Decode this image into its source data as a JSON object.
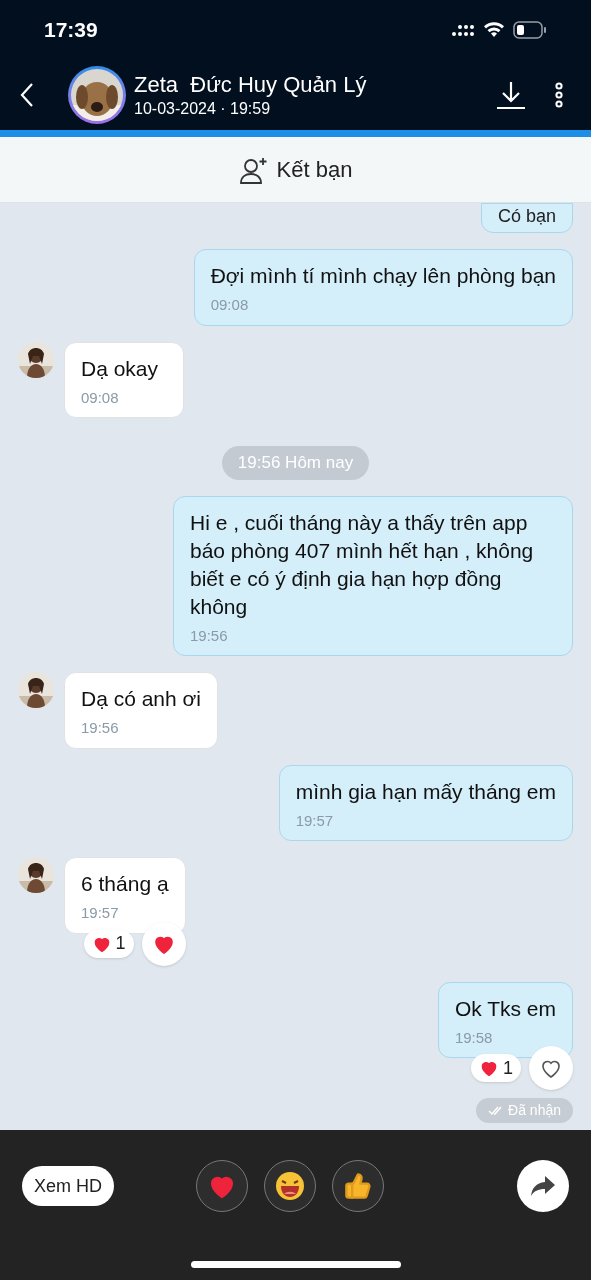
{
  "status_bar": {
    "time": "17:39"
  },
  "header": {
    "name": "Zeta  Đức Huy Quản Lý",
    "subtitle": "10-03-2024 · 19:59"
  },
  "friend_bar": {
    "label": "Kết bạn"
  },
  "messages": [
    {
      "kind": "clipped",
      "text": "Có bạn"
    },
    {
      "kind": "sent",
      "text": "Đợi mình tí mình chạy lên phòng bạn",
      "time": "09:08"
    },
    {
      "kind": "received",
      "text": "Dạ okay",
      "time": "09:08"
    },
    {
      "kind": "date",
      "text": "19:56 Hôm nay"
    },
    {
      "kind": "sent",
      "text": "Hi e , cuối tháng này a thấy trên app báo phòng 407 mình hết hạn , không biết e có ý định gia hạn hợp đồng không",
      "time": "19:56"
    },
    {
      "kind": "received",
      "text": "Dạ có anh ơi",
      "time": "19:56"
    },
    {
      "kind": "sent",
      "text": "mình gia hạn mấy tháng em",
      "time": "19:57"
    },
    {
      "kind": "received",
      "text": "6 tháng ạ",
      "time": "19:57",
      "reaction": {
        "count": "1",
        "reacted": true
      }
    },
    {
      "kind": "sent",
      "text": "Ok Tks em",
      "time": "19:58",
      "reaction": {
        "count": "1",
        "reacted": false
      }
    }
  ],
  "receipt": "Đã nhận",
  "overlay": {
    "hd_button": "Xem HD"
  }
}
